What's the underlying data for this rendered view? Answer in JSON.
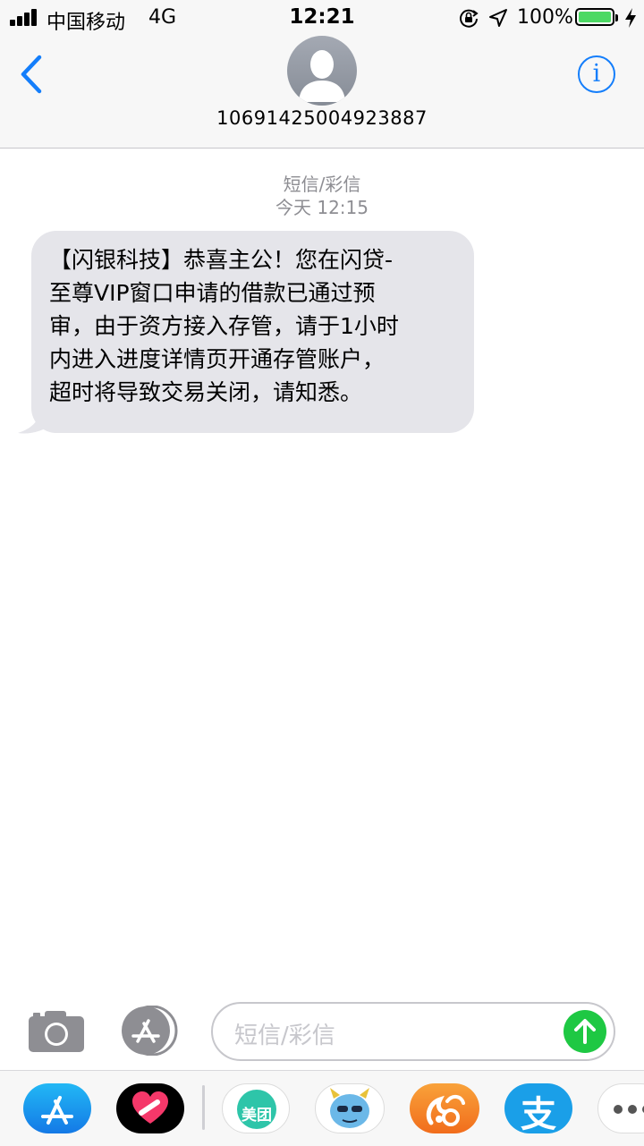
{
  "status_bar": {
    "carrier": "中国移动",
    "network": "4G",
    "time": "12:21",
    "battery_percent": "100%",
    "battery_level": 1.0,
    "icons": [
      "signal-icon",
      "orientation-lock-icon",
      "location-icon",
      "battery-icon",
      "charging-icon"
    ]
  },
  "header": {
    "back_icon": "chevron-left-icon",
    "contact": "10691425004923887",
    "info_icon": "info-icon",
    "info_glyph": "i"
  },
  "conversation": {
    "message_type": "短信/彩信",
    "timestamp": "今天 12:15",
    "messages": [
      {
        "direction": "incoming",
        "lines": [
          "【闪银科技】恭喜主公！您在闪贷-",
          "至尊VIP窗口申请的借款已通过预",
          "审，由于资方接入存管，请于1小时",
          "内进入进度详情页开通存管账户，",
          "超时将导致交易关闭，请知悉。"
        ]
      }
    ]
  },
  "input_bar": {
    "camera_icon": "camera-icon",
    "appstore_icon": "app-store-icon",
    "placeholder": "短信/彩信",
    "send_icon": "arrow-up-icon"
  },
  "app_drawer": {
    "apps": [
      {
        "name": "App Store",
        "icon": "app-store-icon"
      },
      {
        "name": "Digital Touch",
        "icon": "heart-icon"
      },
      {
        "name": "美团",
        "label": "美团",
        "icon": "meituan-icon"
      },
      {
        "name": "QQ",
        "icon": "monster-face-icon"
      },
      {
        "name": "UC",
        "icon": "uc-squirrel-icon"
      },
      {
        "name": "支付宝",
        "label": "支",
        "icon": "alipay-icon"
      },
      {
        "name": "More",
        "icon": "more-icon"
      }
    ]
  },
  "colors": {
    "accent": "#147efb",
    "bubble": "#e5e5ea",
    "send": "#1ec843",
    "meituan": "#2ec5a9",
    "uc": "#f7862a",
    "alipay": "#1a9fe8"
  }
}
